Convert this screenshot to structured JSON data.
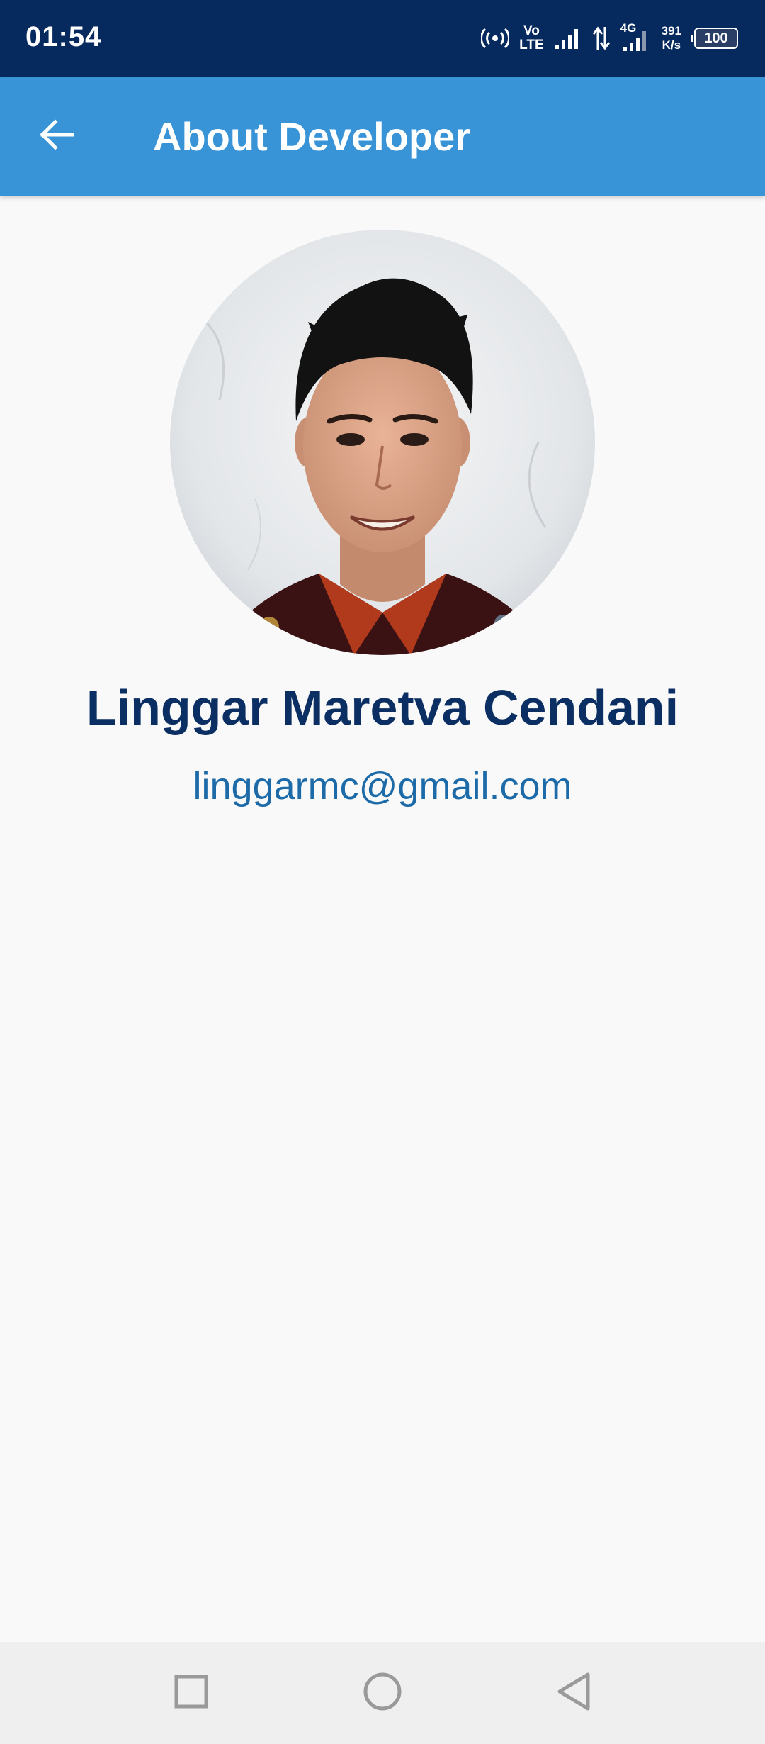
{
  "status_bar": {
    "time": "01:54",
    "vo_label": "Vo",
    "lte_label": "LTE",
    "network_label": "4G",
    "speed_value": "391",
    "speed_unit": "K/s",
    "battery_level": "100",
    "icons": [
      "hotspot-icon",
      "signal-icon",
      "data-arrows-icon",
      "signal-4g-icon",
      "battery-icon"
    ]
  },
  "app_bar": {
    "title": "About Developer",
    "back_icon": "arrow-left-icon",
    "color": "#3894d6"
  },
  "developer": {
    "name": "Linggar Maretva Cendani",
    "email": "linggarmc@gmail.com"
  },
  "nav_bar": {
    "icons": [
      "recents-square-icon",
      "home-circle-icon",
      "back-triangle-icon"
    ]
  },
  "colors": {
    "status_bar": "#062a5e",
    "app_bar": "#3894d6",
    "name_text": "#0b2f63",
    "email_text": "#1c6aa8",
    "background": "#f9f9f9",
    "nav_bar": "#efefef"
  }
}
